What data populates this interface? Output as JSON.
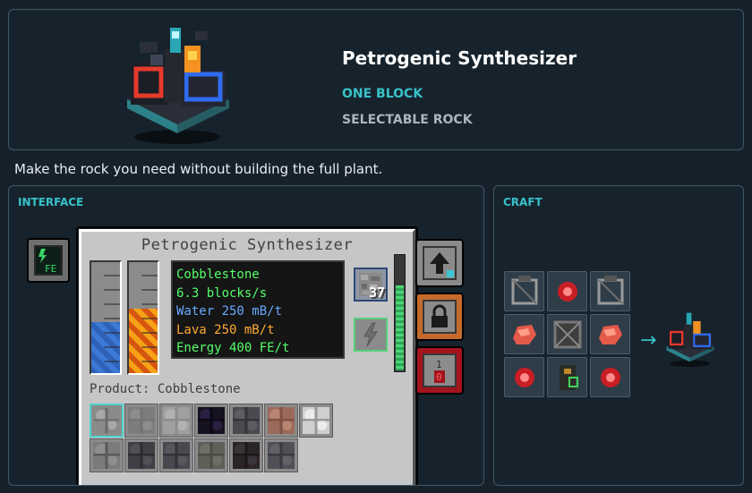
{
  "product": {
    "title": "Petrogenic Synthesizer",
    "tags": [
      "ONE BLOCK",
      "SELECTABLE ROCK"
    ],
    "tagline": "Make the rock you need without building the full plant."
  },
  "interface": {
    "section_label": "INTERFACE",
    "gui_title": "Petrogenic Synthesizer",
    "info_lines": [
      {
        "text": "Cobblestone",
        "color": "#55ff6a"
      },
      {
        "text": "6.3 blocks/s",
        "color": "#55ff6a"
      },
      {
        "text": "Water 250 mB/t",
        "color": "#66aaff"
      },
      {
        "text": "Lava 250 mB/t",
        "color": "#ffaa33"
      },
      {
        "text": "Energy 400 FE/t",
        "color": "#55ff6a"
      }
    ],
    "output_count": "37",
    "product_label": "Product: Cobblestone",
    "water_level": 0.46,
    "lava_level": 0.58,
    "energy_level": 0.75,
    "fe_button_label": "FE",
    "redstone_button": {
      "top": "1",
      "bottom": "0"
    },
    "rocks": [
      {
        "name": "cobblestone",
        "selected": true
      },
      {
        "name": "stone"
      },
      {
        "name": "smooth-stone"
      },
      {
        "name": "obsidian"
      },
      {
        "name": "cobbled-deepslate"
      },
      {
        "name": "granite"
      },
      {
        "name": "diorite"
      },
      {
        "name": "stone-bricks"
      },
      {
        "name": "deepslate"
      },
      {
        "name": "polished-deepslate"
      },
      {
        "name": "tuff"
      },
      {
        "name": "blackstone"
      },
      {
        "name": "basalt"
      }
    ]
  },
  "craft": {
    "section_label": "CRAFT",
    "arrow": "→",
    "grid": [
      "machine-frame",
      "redstone-crystal",
      "machine-frame",
      "raw-copper",
      "iron-frame",
      "raw-copper",
      "redstone-crystal",
      "machine-core",
      "redstone-crystal"
    ]
  }
}
